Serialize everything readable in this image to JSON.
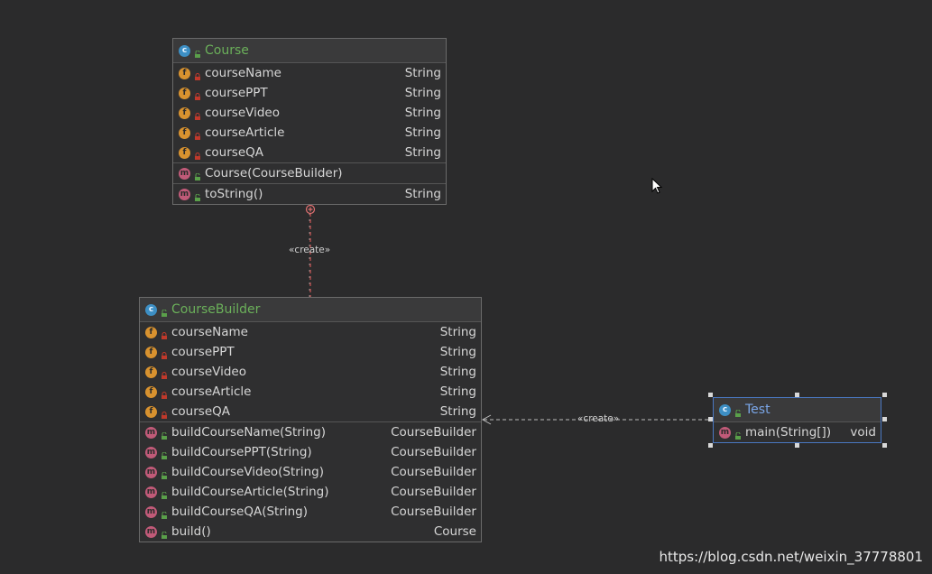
{
  "classes": {
    "course": {
      "title": "Course",
      "fields": [
        {
          "name": "courseName",
          "type": "String"
        },
        {
          "name": "coursePPT",
          "type": "String"
        },
        {
          "name": "courseVideo",
          "type": "String"
        },
        {
          "name": "courseArticle",
          "type": "String"
        },
        {
          "name": "courseQA",
          "type": "String"
        }
      ],
      "constructors": [
        {
          "name": "Course(CourseBuilder)",
          "type": ""
        }
      ],
      "methods": [
        {
          "name": "toString()",
          "type": "String"
        }
      ]
    },
    "builder": {
      "title": "CourseBuilder",
      "fields": [
        {
          "name": "courseName",
          "type": "String"
        },
        {
          "name": "coursePPT",
          "type": "String"
        },
        {
          "name": "courseVideo",
          "type": "String"
        },
        {
          "name": "courseArticle",
          "type": "String"
        },
        {
          "name": "courseQA",
          "type": "String"
        }
      ],
      "methods": [
        {
          "name": "buildCourseName(String)",
          "type": "CourseBuilder"
        },
        {
          "name": "buildCoursePPT(String)",
          "type": "CourseBuilder"
        },
        {
          "name": "buildCourseVideo(String)",
          "type": "CourseBuilder"
        },
        {
          "name": "buildCourseArticle(String)",
          "type": "CourseBuilder"
        },
        {
          "name": "buildCourseQA(String)",
          "type": "CourseBuilder"
        },
        {
          "name": "build()",
          "type": "Course"
        }
      ]
    },
    "test": {
      "title": "Test",
      "methods": [
        {
          "name": "main(String[])",
          "type": "void"
        }
      ]
    }
  },
  "edges": {
    "builder_to_course": "«create»",
    "test_to_builder": "«create»"
  },
  "icons": {
    "class": "class-icon",
    "field": "field-icon",
    "method": "method-icon",
    "private": "lock-icon",
    "public": "unlock-icon"
  },
  "colors": {
    "background": "#2b2b2c",
    "class_title": "#6bb05a",
    "selected_border": "#4a78c2",
    "field_badge": "#d8922f",
    "method_badge": "#c05a78",
    "inner_edge": "#c05050"
  },
  "watermark": "https://blog.csdn.net/weixin_37778801"
}
